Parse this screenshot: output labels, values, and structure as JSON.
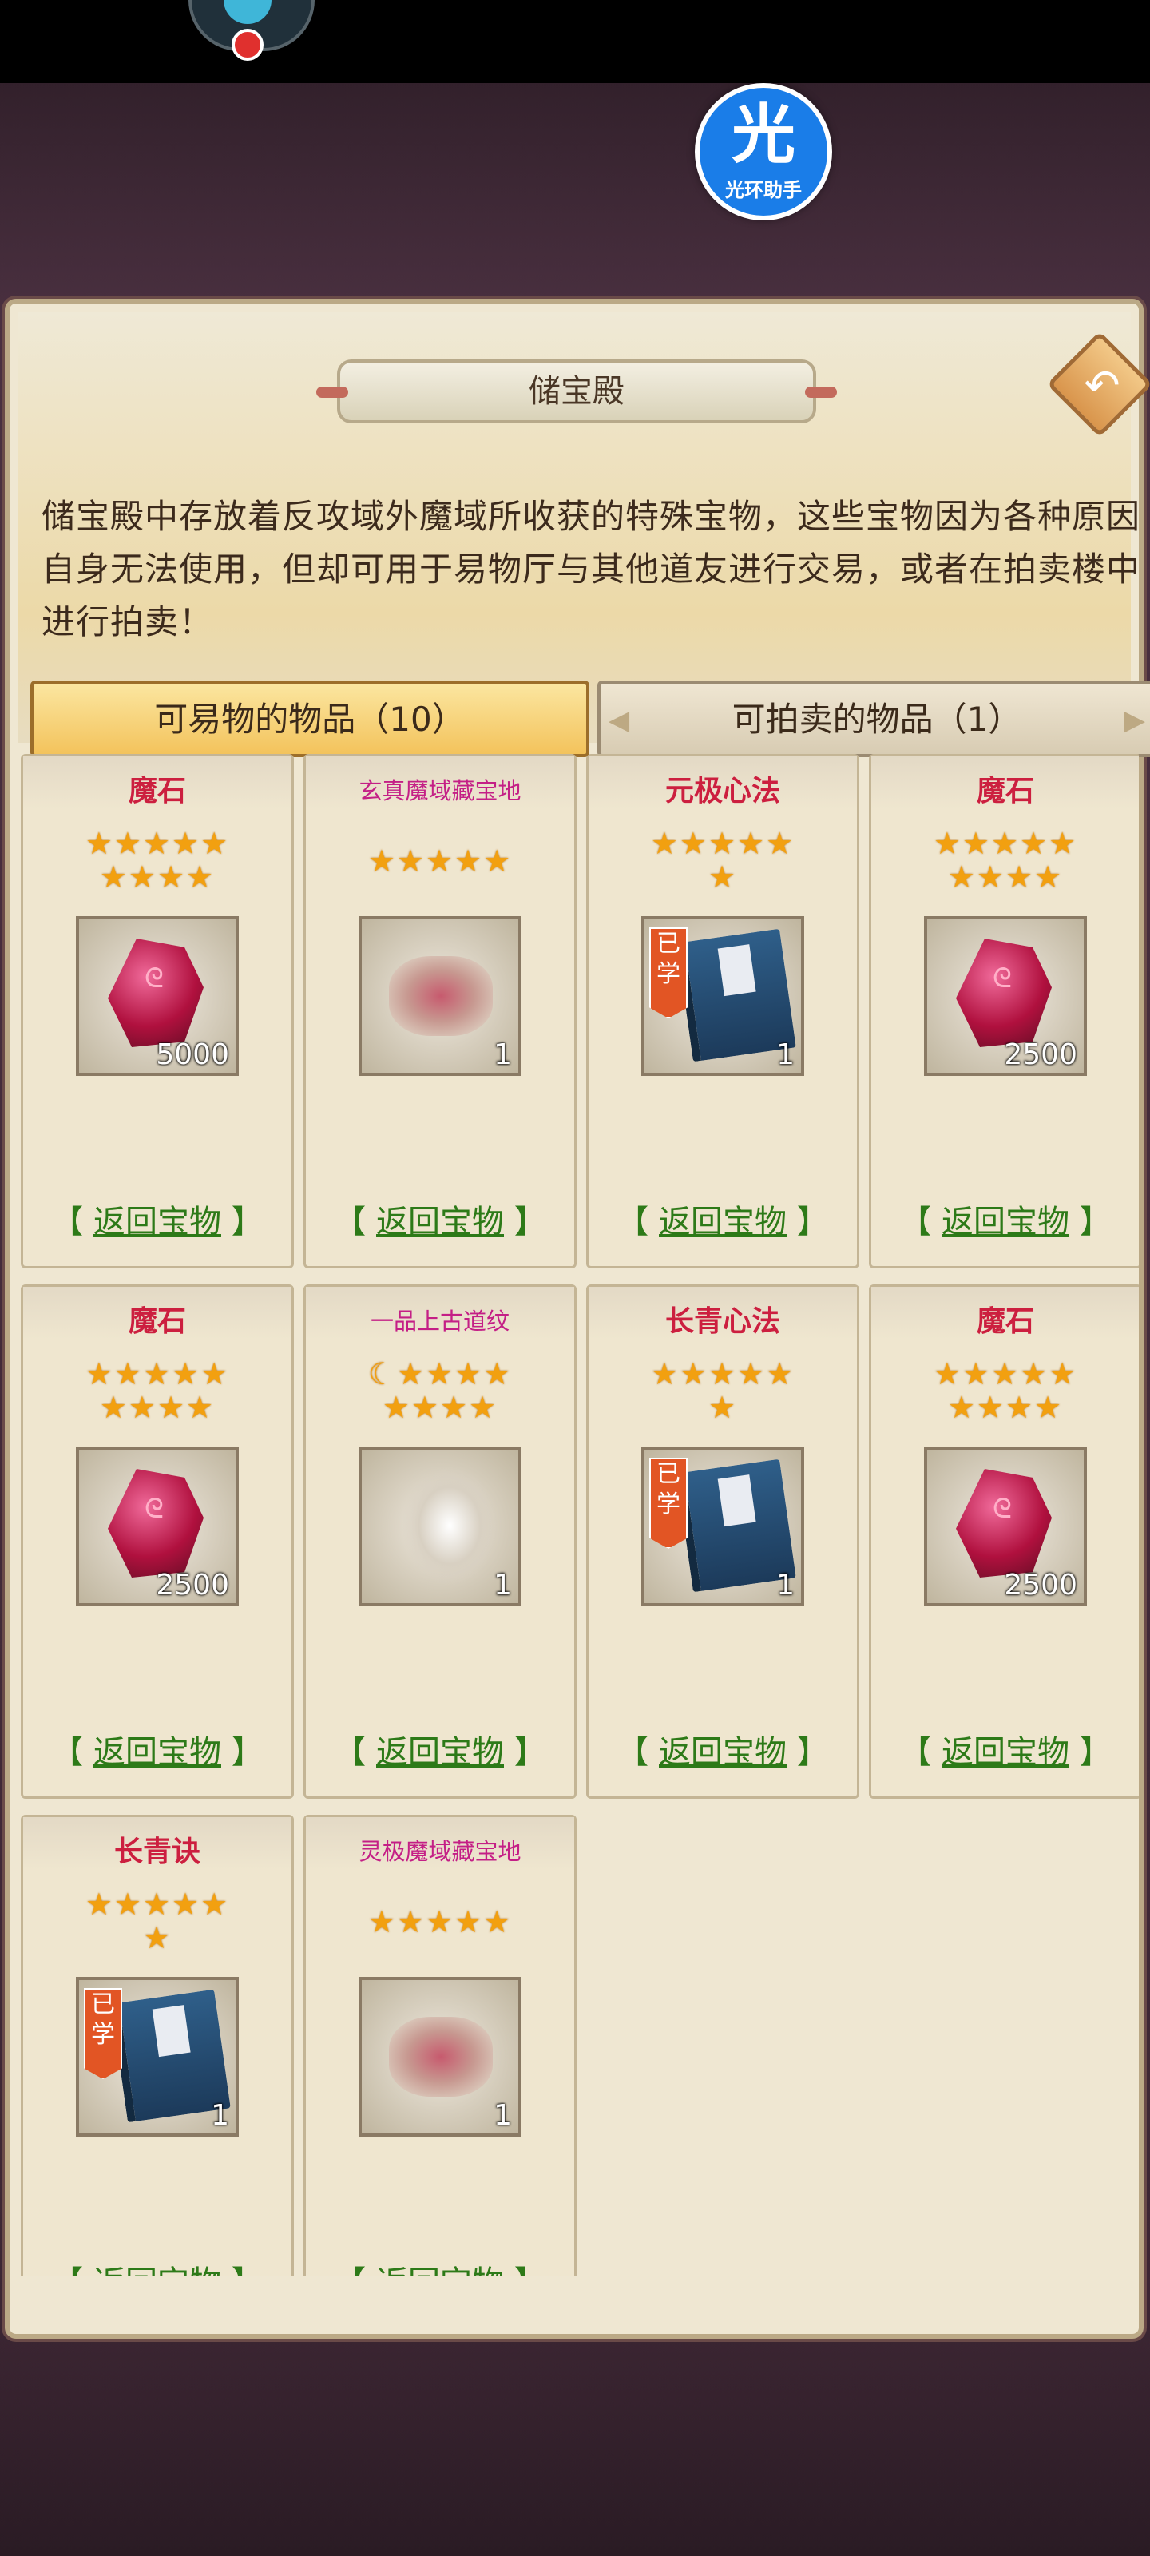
{
  "window": {
    "title": "储宝殿"
  },
  "overlay": {
    "assistant_char": "光",
    "assistant_label": "光环助手"
  },
  "description": "储宝殿中存放着反攻域外魔域所收获的特殊宝物，这些宝物因为各种原因自身无法使用，但却可用于易物厅与其他道友进行交易，或者在拍卖楼中进行拍卖！",
  "tabs": [
    {
      "label": "可易物的物品（10）",
      "active": true
    },
    {
      "label": "可拍卖的物品（1）",
      "active": false
    }
  ],
  "return_label": "返回宝物",
  "learned_label": "已学",
  "items": [
    {
      "name": "魔石",
      "stars_top": "★★★★★",
      "stars_bottom": "★★★★",
      "count": "5000",
      "type": "gem"
    },
    {
      "name": "玄真魔域藏宝地",
      "stars_top": "★★★★★",
      "stars_bottom": "",
      "count": "1",
      "type": "map"
    },
    {
      "name": "元极心法",
      "stars_top": "★★★★★",
      "stars_bottom": "★",
      "count": "1",
      "type": "book"
    },
    {
      "name": "魔石",
      "stars_top": "★★★★★",
      "stars_bottom": "★★★★",
      "count": "2500",
      "type": "gem"
    },
    {
      "name": "魔石",
      "stars_top": "★★★★★",
      "stars_bottom": "★★★★",
      "count": "2500",
      "type": "gem"
    },
    {
      "name": "一品上古道纹",
      "stars_top": "☾★★★★",
      "stars_bottom": "★★★★",
      "count": "1",
      "type": "ribbon"
    },
    {
      "name": "长青心法",
      "stars_top": "★★★★★",
      "stars_bottom": "★",
      "count": "1",
      "type": "book"
    },
    {
      "name": "魔石",
      "stars_top": "★★★★★",
      "stars_bottom": "★★★★",
      "count": "2500",
      "type": "gem"
    },
    {
      "name": "长青诀",
      "stars_top": "★★★★★",
      "stars_bottom": "★",
      "count": "1",
      "type": "book"
    },
    {
      "name": "灵极魔域藏宝地",
      "stars_top": "★★★★★",
      "stars_bottom": "",
      "count": "1",
      "type": "map"
    }
  ],
  "colors": {
    "accent": "#f3c35c",
    "item_name": "#cc1f3f",
    "return_link": "#2d7a18",
    "star": "#f2a010"
  }
}
